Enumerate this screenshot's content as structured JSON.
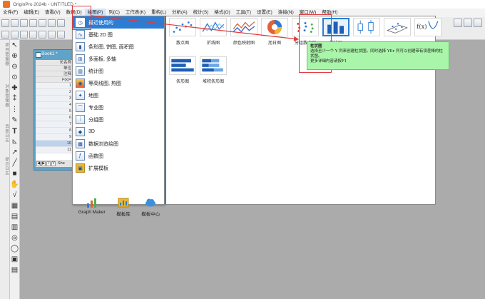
{
  "titlebar": {
    "title": "OriginPro 2024b - UNTITLED *"
  },
  "menubar": {
    "items": [
      "文件(F)",
      "编辑(E)",
      "查看(V)",
      "数据(D)",
      "绘图(P)",
      "列(C)",
      "工作表(K)",
      "重构(L)",
      "分析(A)",
      "统计(S)",
      "格式(O)",
      "工具(T)",
      "设置(E)",
      "连接(N)",
      "窗口(W)",
      "帮助(H)"
    ],
    "active_index": 4
  },
  "side_tabs": [
    "项目管理器",
    "对象管理器",
    "消息日志",
    "提示日志"
  ],
  "book": {
    "title": "Book1 *",
    "header_rows": [
      "长名称",
      "单位",
      "注释",
      "F(x)="
    ],
    "row_numbers": [
      "1",
      "2",
      "3",
      "4",
      "5",
      "6",
      "7",
      "8",
      "9",
      "10",
      "11"
    ],
    "selected_row": "10",
    "sheet_nav": [
      "◀",
      "▶",
      "+",
      "V"
    ],
    "sheet_tab": "She"
  },
  "plot_menu": {
    "items": [
      {
        "label": "最近使用的",
        "icon": "clock-icon",
        "selected": true
      },
      {
        "label": "基础 2D 图",
        "icon": "line-2d-icon"
      },
      {
        "label": "条形图, 饼图, 面积图",
        "icon": "bar-pie-icon"
      },
      {
        "label": "多面板, 多轴",
        "icon": "multi-panel-icon"
      },
      {
        "label": "统计图",
        "icon": "statistics-icon"
      },
      {
        "label": "等高线图, 热图",
        "icon": "contour-icon"
      },
      {
        "label": "地图",
        "icon": "map-icon"
      },
      {
        "label": "专业图",
        "icon": "specialized-icon"
      },
      {
        "label": "分组图",
        "icon": "grouped-icon"
      },
      {
        "label": "3D",
        "icon": "3d-icon"
      },
      {
        "label": "数据浏览绘图",
        "icon": "data-explore-icon"
      },
      {
        "label": "函数图",
        "icon": "function-icon"
      },
      {
        "label": "扩展模板",
        "icon": "extend-template-icon"
      }
    ],
    "bottom": [
      {
        "label": "Graph Maker",
        "icon": "graph-maker-icon"
      },
      {
        "label": "模板库",
        "icon": "template-library-icon"
      },
      {
        "label": "模板中心",
        "icon": "template-center-icon"
      }
    ]
  },
  "gallery": {
    "row1": [
      {
        "caption": "散点图",
        "icon": "scatter-thumb"
      },
      {
        "caption": "折线图",
        "icon": "line-thumb"
      },
      {
        "caption": "颜色映射图",
        "icon": "colormap-thumb"
      },
      {
        "caption": "旭日图",
        "icon": "sunburst-thumb"
      },
      {
        "caption": "分组散点图",
        "icon": "grouped-scatter-thumb"
      },
      {
        "caption": "柱状图",
        "icon": "column-thumb",
        "selected": true
      },
      {
        "caption": "",
        "icon": "box-thumb"
      },
      {
        "caption": "",
        "icon": "3d-scatter-thumb"
      },
      {
        "caption": "",
        "icon": "function-thumb"
      }
    ],
    "row2": [
      {
        "caption": "条形图",
        "icon": "bar-thumb"
      },
      {
        "caption": "堆积条形图",
        "icon": "stacked-bar-thumb"
      }
    ]
  },
  "tooltip": {
    "title": "柱状图",
    "line1": "选择至少一个 Y 列来创建柱状图。同时选择 YEr 列可以创建带有误差棒的柱状图。",
    "line2": "更多详细内容请按F1"
  },
  "colors": {
    "accent": "#2c7dd3",
    "highlight": "#e23a3a",
    "tooltip_bg": "#a9f5a9",
    "book": "#5fa3c8"
  }
}
